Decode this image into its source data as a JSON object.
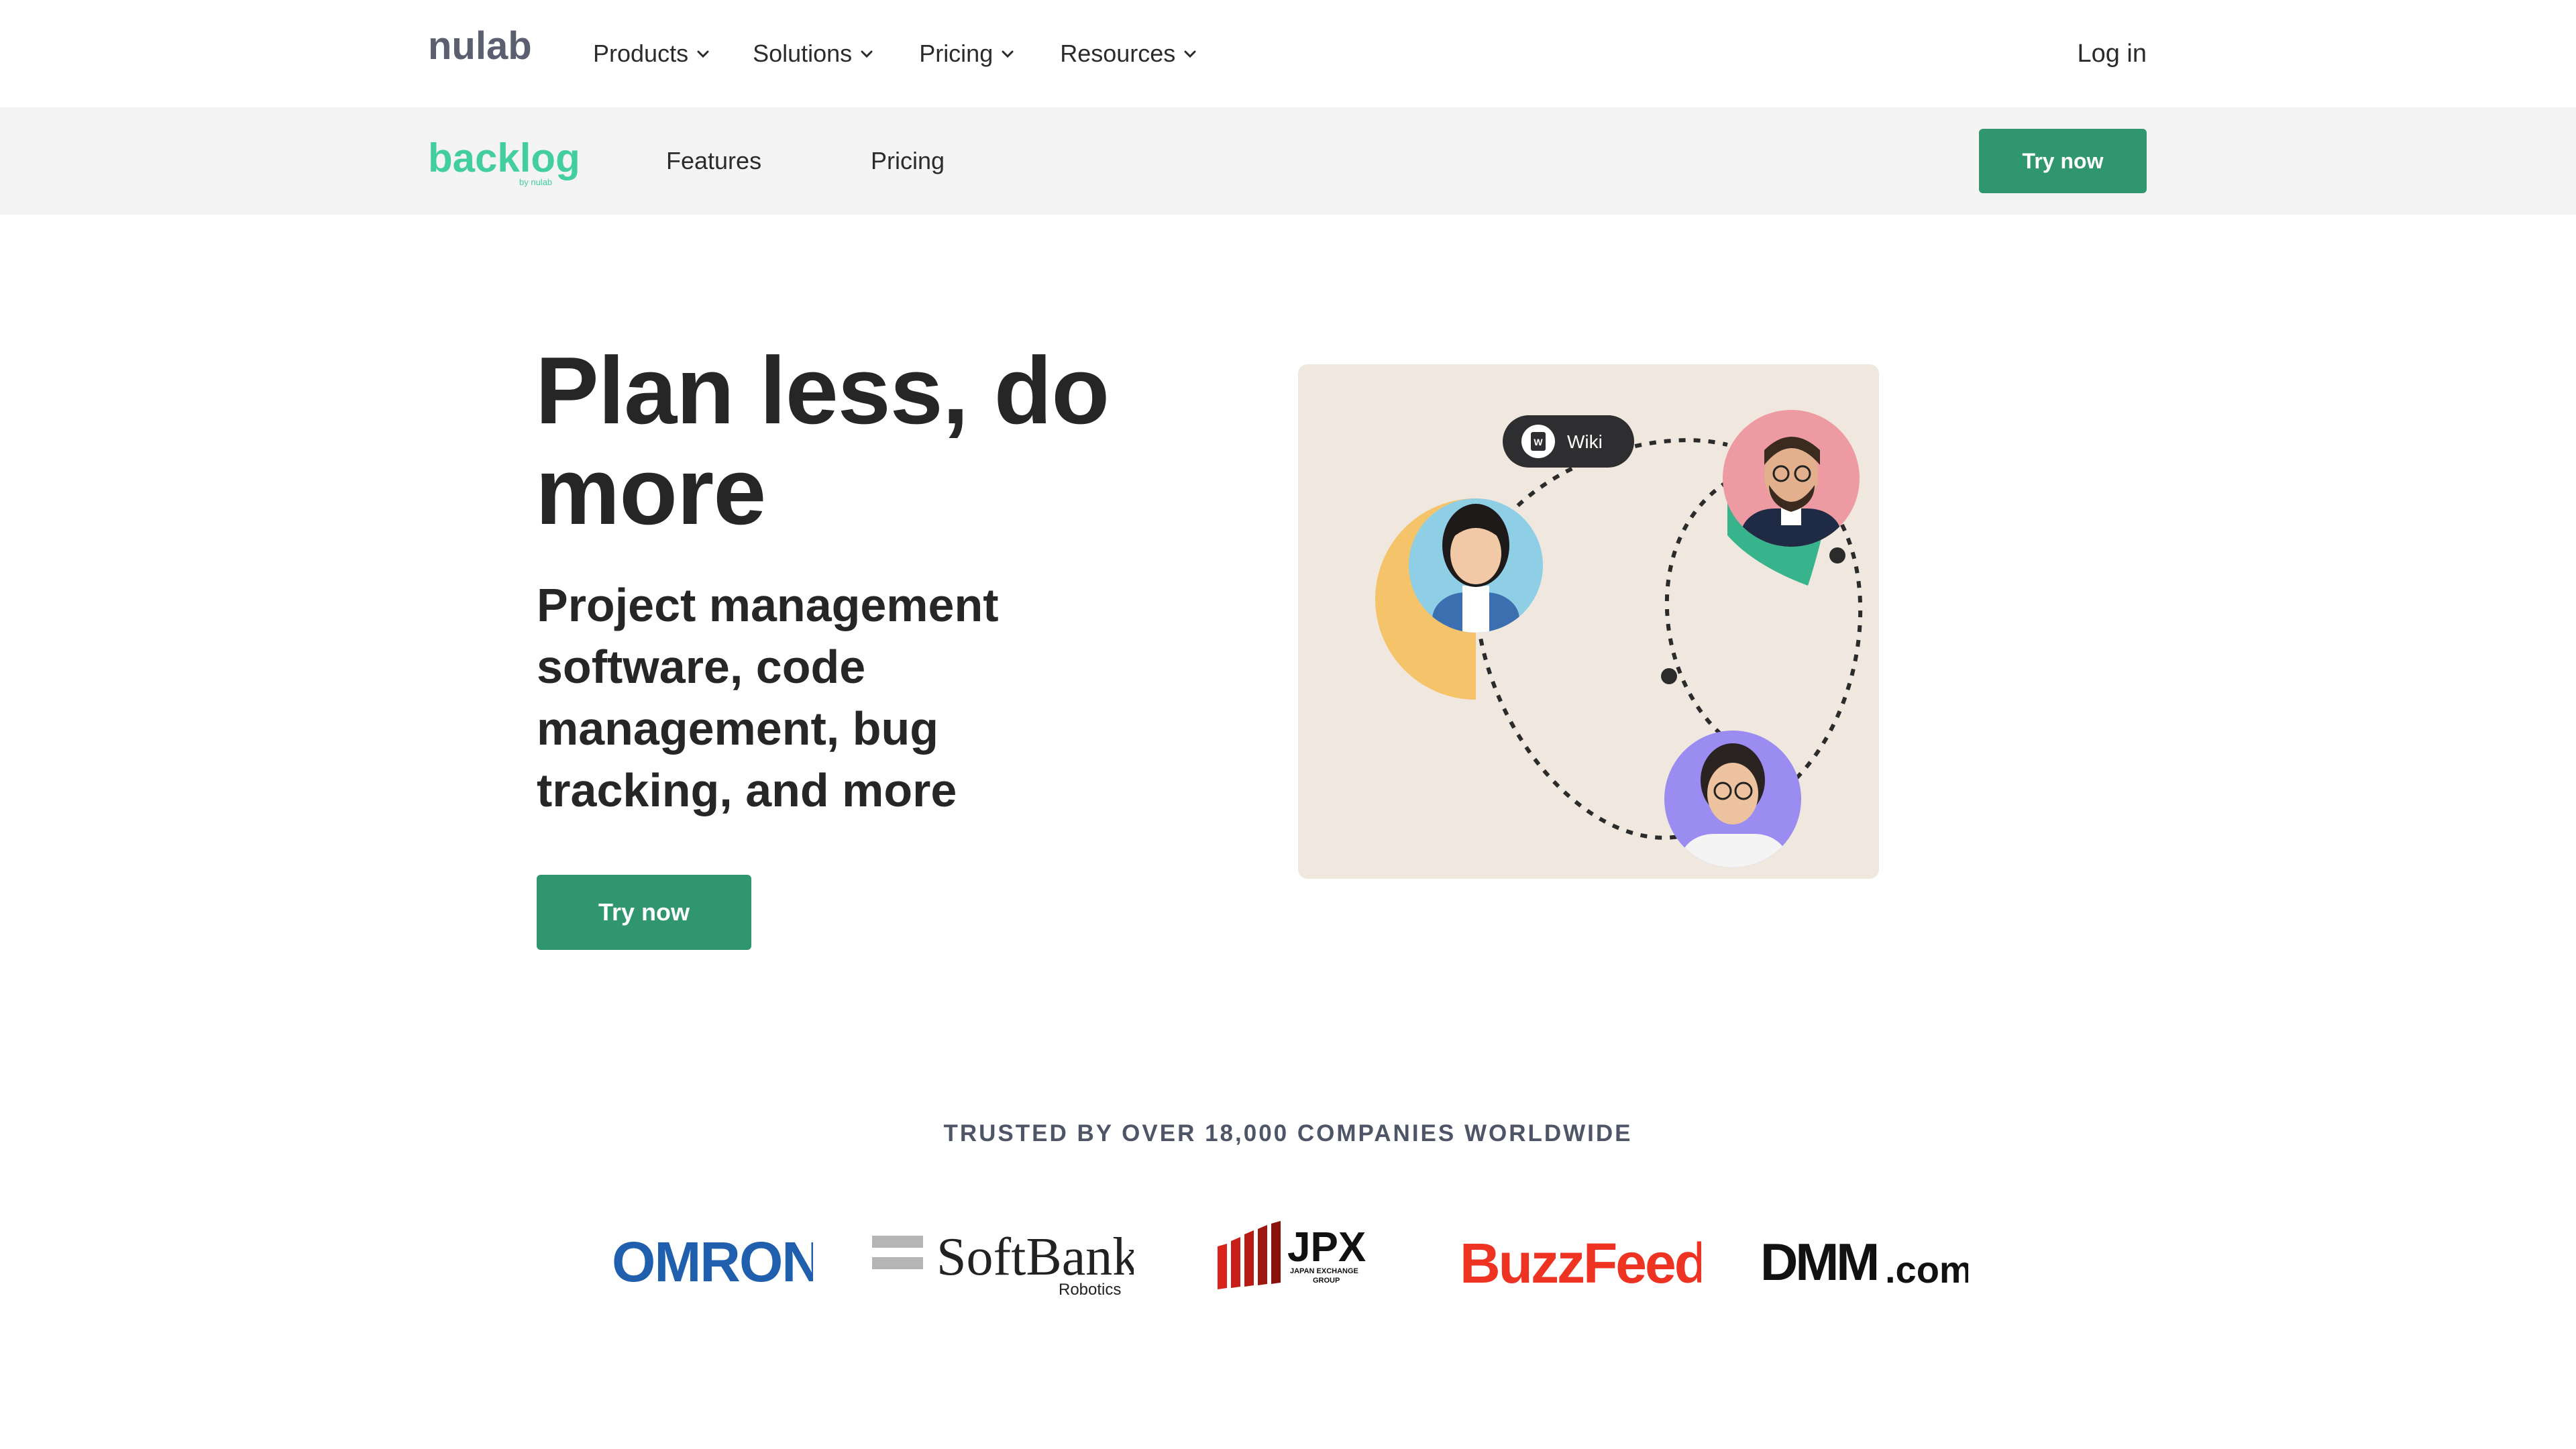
{
  "global_nav": {
    "brand": "nulab",
    "items": [
      {
        "label": "Products"
      },
      {
        "label": "Solutions"
      },
      {
        "label": "Pricing"
      },
      {
        "label": "Resources"
      }
    ],
    "login": "Log in"
  },
  "product_nav": {
    "brand": "backlog",
    "brand_byline": "by nulab",
    "links": [
      {
        "label": "Features"
      },
      {
        "label": "Pricing"
      }
    ],
    "cta": "Try now"
  },
  "hero": {
    "title": "Plan less, do more",
    "subtitle": "Project management software, code management, bug tracking, and more",
    "cta": "Try now",
    "illustration": {
      "chip_label": "Wiki",
      "chip_icon": "W"
    }
  },
  "trusted": {
    "heading": "TRUSTED BY OVER 18,000 COMPANIES WORLDWIDE",
    "logos": {
      "omron": "OMRON",
      "softbank": "SoftBank",
      "softbank_sub": "Robotics",
      "jpx": "JPX",
      "jpx_sub1": "JAPAN EXCHANGE",
      "jpx_sub2": "GROUP",
      "buzzfeed": "BuzzFeed",
      "dmm": "DMM",
      "dmm_suffix": ".com"
    }
  },
  "colors": {
    "brand_green": "#2f9670",
    "backlog_teal": "#42ce9f",
    "nulab_gray": "#5b5f6f",
    "subnav_bg": "#f4f4f5",
    "art_bg": "#f0e8df",
    "omron_blue": "#1f5fad",
    "buzzfeed_red": "#ee3322"
  }
}
